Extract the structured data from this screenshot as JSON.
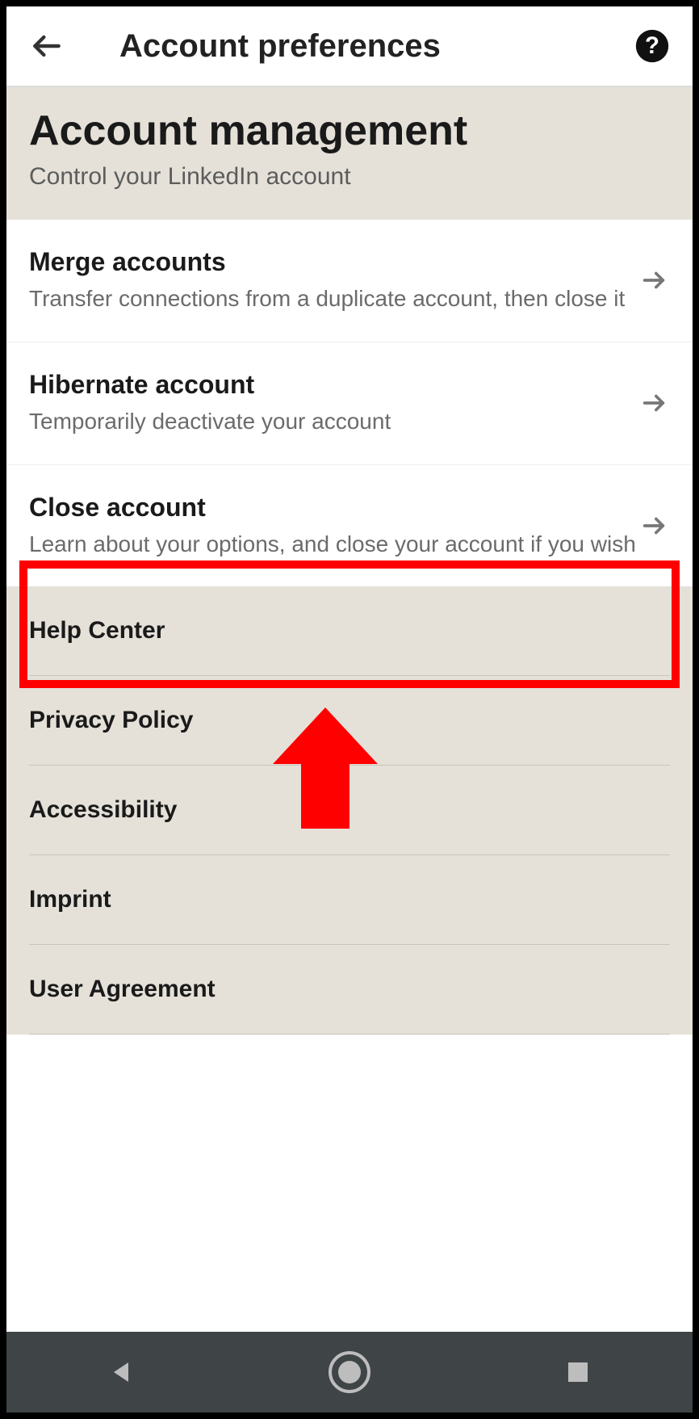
{
  "header": {
    "title": "Account preferences"
  },
  "section": {
    "heading": "Account management",
    "subheading": "Control your LinkedIn account"
  },
  "items": [
    {
      "title": "Merge accounts",
      "desc": "Transfer connections from a duplicate account, then close it"
    },
    {
      "title": "Hibernate account",
      "desc": "Temporarily deactivate your account"
    },
    {
      "title": "Close account",
      "desc": "Learn about your options, and close your account if you wish"
    }
  ],
  "footer_links": [
    "Help Center",
    "Privacy Policy",
    "Accessibility",
    "Imprint",
    "User Agreement"
  ],
  "annotation": {
    "highlight_index": 2,
    "colors": {
      "highlight": "#ff0000"
    }
  }
}
